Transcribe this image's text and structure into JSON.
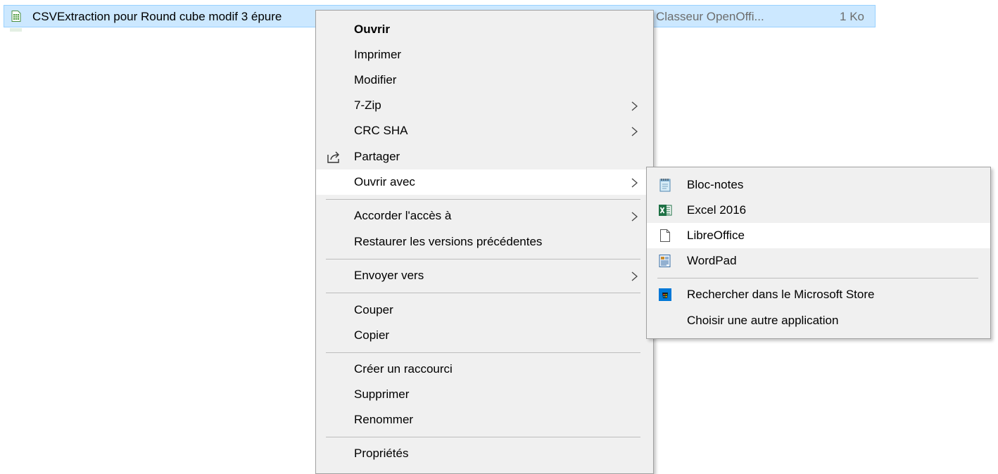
{
  "file": {
    "name": "CSVExtraction pour Round cube modif 3 épure",
    "type": "Classeur OpenOffi...",
    "size": "1 Ko",
    "icon": "spreadsheet-file-icon"
  },
  "context_menu": {
    "items": [
      {
        "label": "Ouvrir",
        "bold": true
      },
      {
        "label": "Imprimer"
      },
      {
        "label": "Modifier"
      },
      {
        "label": "7-Zip",
        "submenu": true
      },
      {
        "label": "CRC SHA",
        "submenu": true
      },
      {
        "label": "Partager",
        "icon": "share-icon"
      },
      {
        "label": "Ouvrir avec",
        "submenu": true,
        "highlighted": true
      },
      {
        "label": "Accorder l'accès à",
        "submenu": true
      },
      {
        "label": "Restaurer les versions précédentes"
      },
      {
        "label": "Envoyer vers",
        "submenu": true
      },
      {
        "label": "Couper"
      },
      {
        "label": "Copier"
      },
      {
        "label": "Créer un raccourci"
      },
      {
        "label": "Supprimer"
      },
      {
        "label": "Renommer"
      },
      {
        "label": "Propriétés"
      }
    ]
  },
  "open_with_submenu": {
    "items": [
      {
        "label": "Bloc-notes",
        "icon": "notepad-icon"
      },
      {
        "label": "Excel 2016",
        "icon": "excel-icon"
      },
      {
        "label": "LibreOffice",
        "icon": "blank-document-icon",
        "highlighted": true
      },
      {
        "label": "WordPad",
        "icon": "wordpad-icon"
      },
      {
        "label": "Rechercher dans le Microsoft Store",
        "icon": "microsoft-store-icon"
      },
      {
        "label": "Choisir une autre application"
      }
    ]
  },
  "colors": {
    "selection": "#cce8ff",
    "menu_background": "#f0f0f0",
    "hover": "#ffffff",
    "excel_green": "#1e7145",
    "store_blue": "#0078d7"
  }
}
